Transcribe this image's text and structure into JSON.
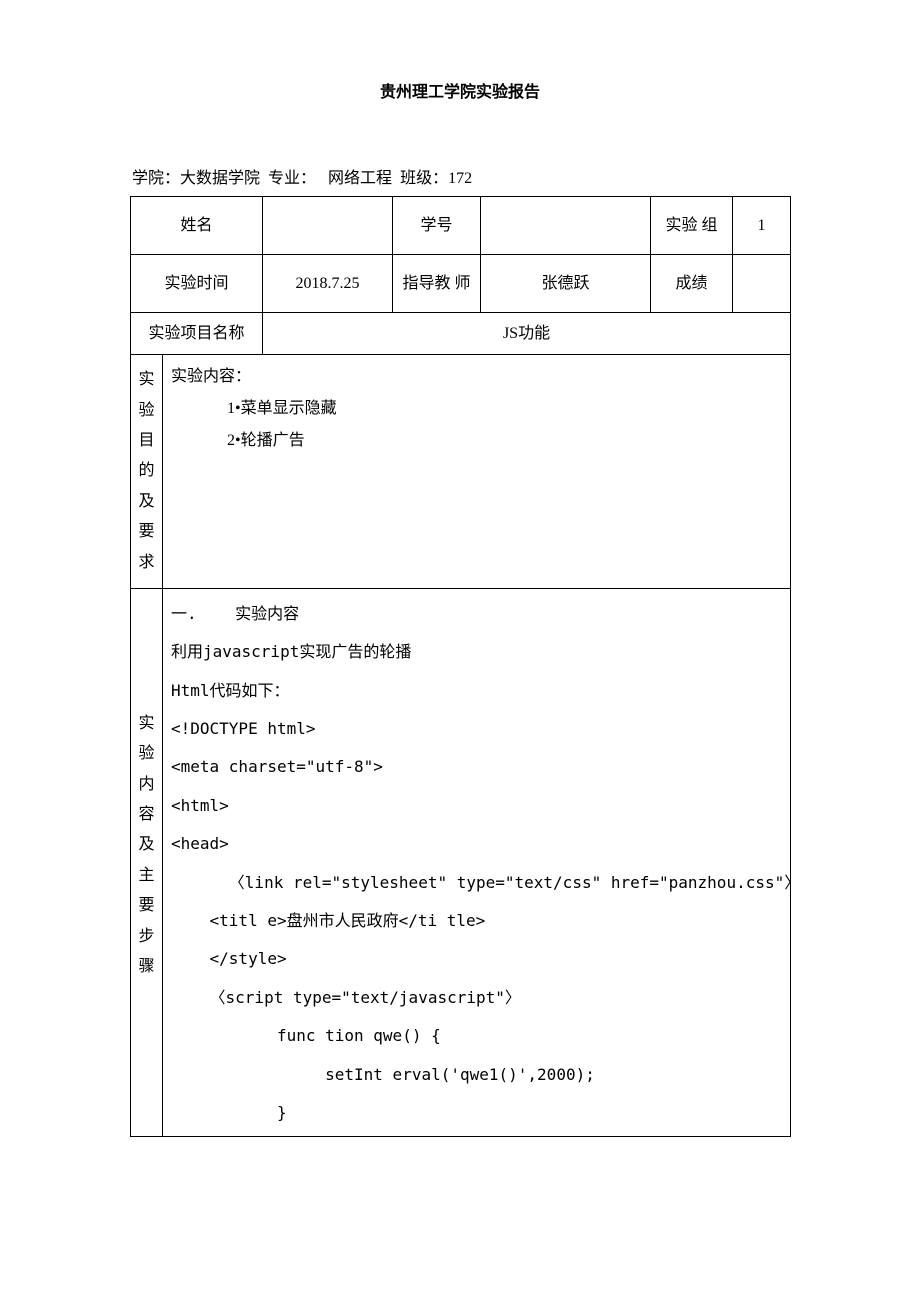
{
  "title": "贵州理工学院实验报告",
  "header": {
    "college_label": "学院：",
    "college_value": "大数据学院",
    "major_label": "专业：",
    "major_value": "网络工程",
    "class_label": "班级：",
    "class_value": "172"
  },
  "table": {
    "row1": {
      "name_label": "姓名",
      "name_value": "",
      "id_label": "学号",
      "id_value": "",
      "group_label": "实验 组",
      "group_value": "1"
    },
    "row2": {
      "time_label": "实验时间",
      "time_value": "2018.7.25",
      "teacher_label": "指导教 师",
      "teacher_value": "张德跃",
      "score_label": "成绩",
      "score_value": ""
    },
    "row3": {
      "project_label": "实验项目名称",
      "project_value": "JS功能"
    },
    "purpose": {
      "side_label": "实验目的及要求",
      "line1": "实验内容：",
      "line2": "1•菜单显示隐藏",
      "line3": "2•轮播广告"
    },
    "steps": {
      "side_label": "实验内容及主要步骤",
      "l1": "一.    实验内容",
      "l2": "利用javascript实现广告的轮播",
      "l3": "Html代码如下：",
      "l4": "<!DOCTYPE html>",
      "l5": "<meta charset=\"utf-8\">",
      "l6": "<html>",
      "l7": "<head>",
      "l8": "      〈link rel=\"stylesheet\" type=\"text/css\" href=\"panzhou.css\"〉",
      "l9": "    <titl e>盘州市人民政府</ti tle>",
      "l10": "    </style>",
      "l11": "    〈script type=\"text/javascript\"〉",
      "l12": "           func tion qwe() {",
      "l13": "                setInt erval('qwe1()',2000);",
      "l14": "           }"
    }
  }
}
